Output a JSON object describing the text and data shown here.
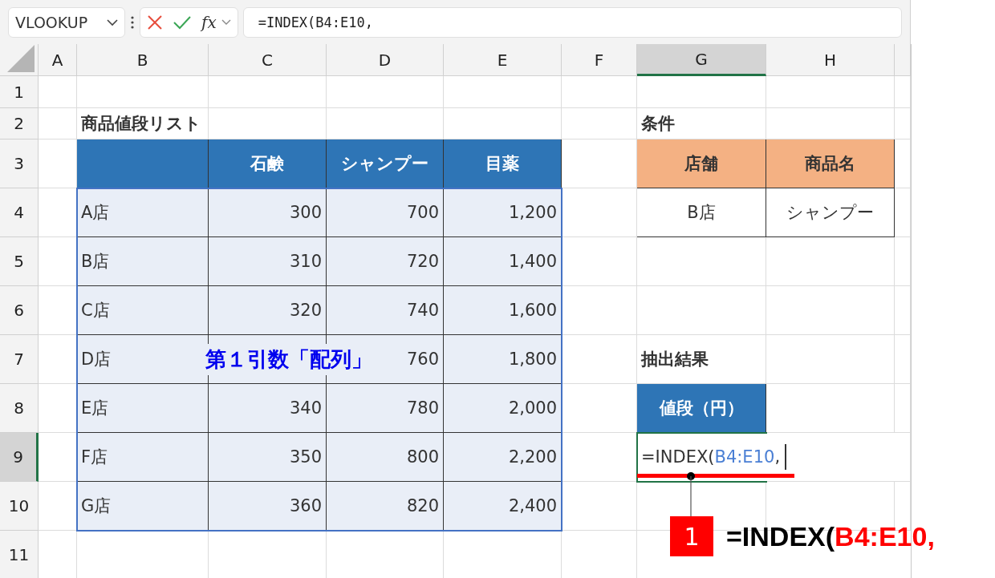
{
  "name_box": {
    "value": "VLOOKUP"
  },
  "function_button": {
    "label": "fx"
  },
  "formula_bar": {
    "value": "=INDEX(B4:E10,"
  },
  "column_headers": [
    {
      "label": "A",
      "selected": false
    },
    {
      "label": "B",
      "selected": false
    },
    {
      "label": "C",
      "selected": false
    },
    {
      "label": "D",
      "selected": false
    },
    {
      "label": "E",
      "selected": false
    },
    {
      "label": "F",
      "selected": false
    },
    {
      "label": "G",
      "selected": true
    },
    {
      "label": "H",
      "selected": false
    }
  ],
  "row_headers": [
    {
      "label": "1",
      "selected": false
    },
    {
      "label": "2",
      "selected": false
    },
    {
      "label": "3",
      "selected": false
    },
    {
      "label": "4",
      "selected": false
    },
    {
      "label": "5",
      "selected": false
    },
    {
      "label": "6",
      "selected": false
    },
    {
      "label": "7",
      "selected": false
    },
    {
      "label": "8",
      "selected": false
    },
    {
      "label": "9",
      "selected": true
    },
    {
      "label": "10",
      "selected": false
    },
    {
      "label": "11",
      "selected": false
    }
  ],
  "price_table": {
    "title": "商品値段リスト",
    "columns": [
      "石鹸",
      "シャンプー",
      "目薬"
    ],
    "rows": [
      {
        "store": "A店",
        "values": [
          "300",
          "700",
          "1,200"
        ]
      },
      {
        "store": "B店",
        "values": [
          "310",
          "720",
          "1,400"
        ]
      },
      {
        "store": "C店",
        "values": [
          "320",
          "740",
          "1,600"
        ]
      },
      {
        "store": "D店",
        "values": [
          "760",
          "1,800"
        ]
      },
      {
        "store": "E店",
        "values": [
          "340",
          "780",
          "2,000"
        ]
      },
      {
        "store": "F店",
        "values": [
          "350",
          "800",
          "2,200"
        ]
      },
      {
        "store": "G店",
        "values": [
          "360",
          "820",
          "2,400"
        ]
      }
    ]
  },
  "conditions": {
    "title": "条件",
    "columns": [
      "店舗",
      "商品名"
    ],
    "values": [
      "B店",
      "シャンプー"
    ]
  },
  "result": {
    "title": "抽出結果",
    "header": "値段（円）",
    "editing": {
      "prefix": "=INDEX(",
      "range": "B4:E10",
      "suffix": ","
    }
  },
  "array_label": "第１引数「配列」",
  "callout": {
    "number": "1",
    "prefix": "=INDEX(",
    "range": "B4:E10",
    "suffix": ","
  }
}
